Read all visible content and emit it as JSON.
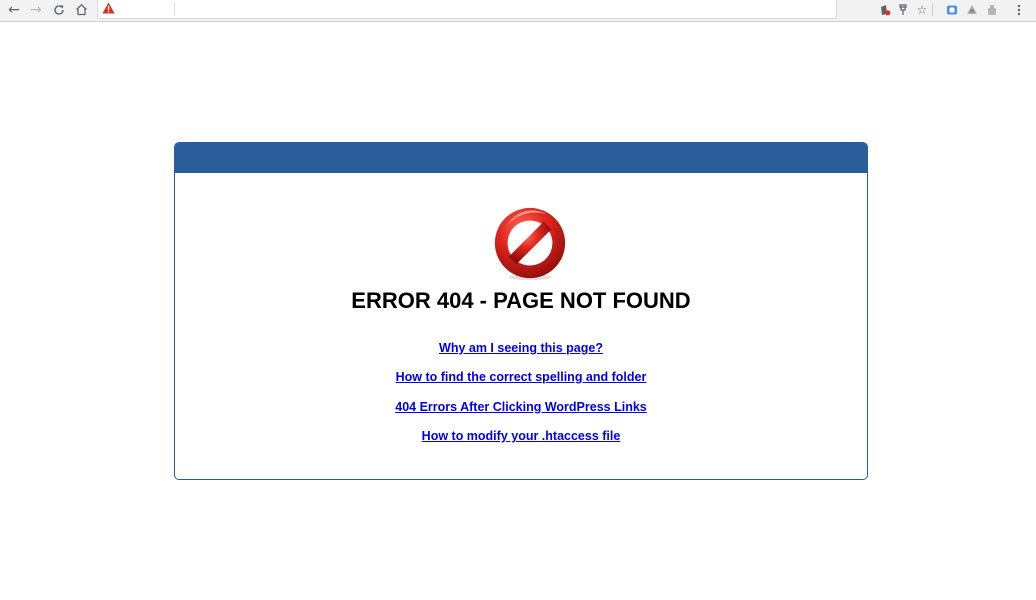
{
  "browser": {
    "nav": {
      "back_icon": "arrow-left-icon",
      "forward_icon": "arrow-right-icon",
      "reload_icon": "reload-icon",
      "home_icon": "home-icon"
    },
    "omnibox": {
      "security_icon": "warning-triangle-icon",
      "security_color": "#d93025"
    },
    "toolbar_icons": [
      "extension-icon",
      "pin-icon",
      "star-icon",
      "extension-icon",
      "extension-icon",
      "extension-icon",
      "menu-icon"
    ]
  },
  "page": {
    "header_color": "#2b5d9c",
    "border_color": "#2a5d9f",
    "symbol": "no-entry-icon",
    "symbol_color": "#d0201b",
    "title": "ERROR 404 - PAGE NOT FOUND",
    "links": [
      "Why am I seeing this page?",
      "How to find the correct spelling and folder",
      "404 Errors After Clicking WordPress Links",
      "How to modify your .htaccess file"
    ],
    "link_color": "#0000ee"
  }
}
